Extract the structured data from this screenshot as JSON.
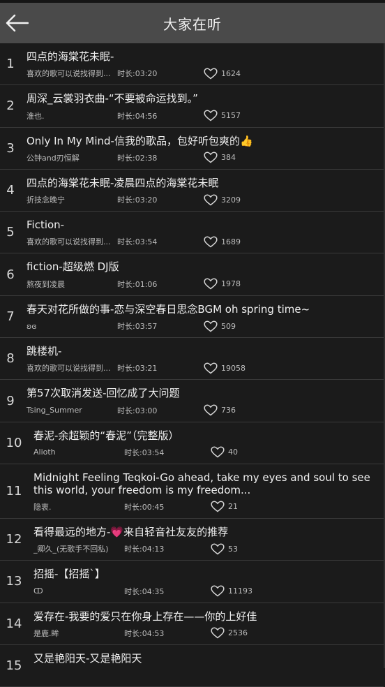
{
  "header": {
    "title": "大家在听"
  },
  "songs": [
    {
      "num": "1",
      "title": "四点的海棠花未眠-",
      "artist": "喜欢的歌可以说找得到...",
      "duration": "时长:03:20",
      "likes": "1624"
    },
    {
      "num": "2",
      "title": "周深_云裳羽衣曲-“不要被命运找到。”",
      "artist": "淮也.",
      "duration": "时长:04:56",
      "likes": "5157"
    },
    {
      "num": "3",
      "title": "Only In My Mind-信我的歌品，包好听包爽的👍",
      "artist": "公钟and刃恒解",
      "duration": "时长:02:38",
      "likes": "384"
    },
    {
      "num": "4",
      "title": "四点的海棠花未眠-凌晨四点的海棠花未眠",
      "artist": "折技念晚宁",
      "duration": "时长:03:20",
      "likes": "3209"
    },
    {
      "num": "5",
      "title": "Fiction-",
      "artist": "喜欢的歌可以说找得到...",
      "duration": "时长:03:54",
      "likes": "1689"
    },
    {
      "num": "6",
      "title": "fiction-超级燃  DJ版",
      "artist": "熬夜到凌晨",
      "duration": "时长:01:06",
      "likes": "1978"
    },
    {
      "num": "7",
      "title": "春天对花所做的事-恋与深空春日思念BGM  oh spring time~",
      "artist": "ʚɞ",
      "duration": "时长:03:57",
      "likes": "509"
    },
    {
      "num": "8",
      "title": "跳楼机-",
      "artist": "喜欢的歌可以说找得到...",
      "duration": "时长:03:21",
      "likes": "19058"
    },
    {
      "num": "9",
      "title": "第57次取消发送-回忆成了大问题",
      "artist": "Tsing_Summer",
      "duration": "时长:03:00",
      "likes": "736"
    },
    {
      "num": "10",
      "title": "春泥-余超颖的“春泥”（完整版）",
      "artist": "Alioth",
      "duration": "时长:03:54",
      "likes": "40"
    },
    {
      "num": "11",
      "title": "Midnight Feeling Teqkoi-Go ahead, take my eyes and soul to see this world, your freedom is my freedom...",
      "artist": "隐衷.",
      "duration": "时长:00:45",
      "likes": "21"
    },
    {
      "num": "12",
      "title": "看得最远的地方-💗来自轻音社友友的推荐",
      "artist": "_卿久_(无歌手不回私)",
      "duration": "时长:04:13",
      "likes": "53"
    },
    {
      "num": "13",
      "title": "招摇-【招摇`】",
      "artist": "ↀ",
      "duration": "时长:04:35",
      "likes": "11193"
    },
    {
      "num": "14",
      "title": "爱存在-我要的爱只在你身上存在——你的上好佳",
      "artist": "是鹿.眸",
      "duration": "时长:04:53",
      "likes": "2536"
    },
    {
      "num": "15",
      "title": "又是艳阳天-又是艳阳天",
      "artist": "",
      "duration": "",
      "likes": ""
    }
  ]
}
